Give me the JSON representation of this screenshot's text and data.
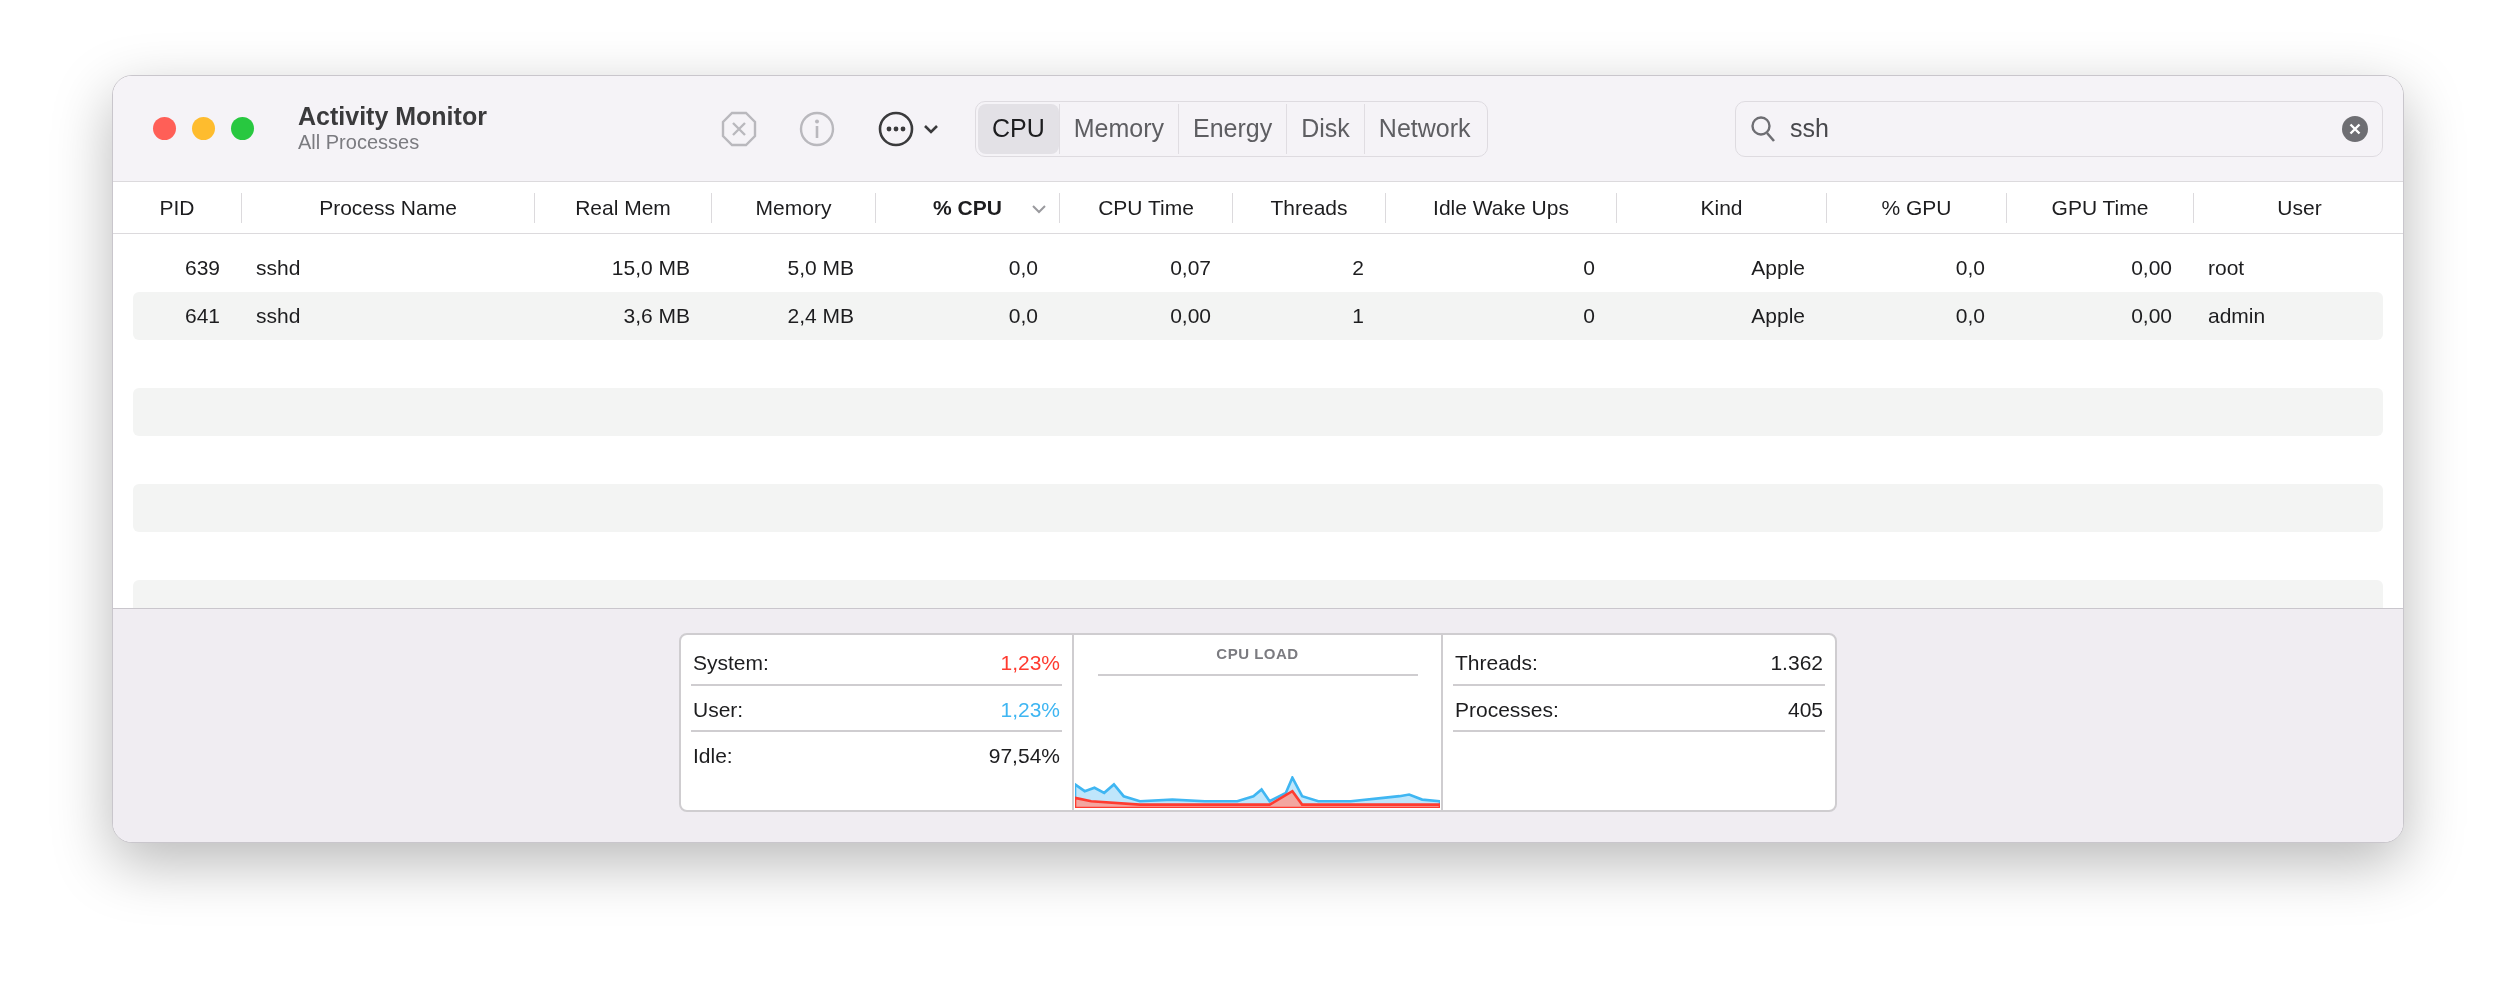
{
  "window": {
    "title": "Activity Monitor",
    "subtitle": "All Processes"
  },
  "tabs": [
    {
      "label": "CPU",
      "selected": true
    },
    {
      "label": "Memory",
      "selected": false
    },
    {
      "label": "Energy",
      "selected": false
    },
    {
      "label": "Disk",
      "selected": false
    },
    {
      "label": "Network",
      "selected": false
    }
  ],
  "search": {
    "value": "ssh"
  },
  "table": {
    "columns": [
      {
        "label": "PID",
        "sorted": false
      },
      {
        "label": "Process Name",
        "sorted": false
      },
      {
        "label": "Real Mem",
        "sorted": false
      },
      {
        "label": "Memory",
        "sorted": false
      },
      {
        "label": "% CPU",
        "sorted": true
      },
      {
        "label": "CPU Time",
        "sorted": false
      },
      {
        "label": "Threads",
        "sorted": false
      },
      {
        "label": "Idle Wake Ups",
        "sorted": false
      },
      {
        "label": "Kind",
        "sorted": false
      },
      {
        "label": "% GPU",
        "sorted": false
      },
      {
        "label": "GPU Time",
        "sorted": false
      },
      {
        "label": "User",
        "sorted": false
      }
    ],
    "rows": [
      [
        "639",
        "sshd",
        "15,0 MB",
        "5,0 MB",
        "0,0",
        "0,07",
        "2",
        "0",
        "Apple",
        "0,0",
        "0,00",
        "root"
      ],
      [
        "641",
        "sshd",
        "3,6 MB",
        "2,4 MB",
        "0,0",
        "0,00",
        "1",
        "0",
        "Apple",
        "0,0",
        "0,00",
        "admin"
      ]
    ]
  },
  "summary": {
    "cpu": [
      {
        "label": "System:",
        "value": "1,23%",
        "color": "#ff3b30"
      },
      {
        "label": "User:",
        "value": "1,23%",
        "color": "#3fb6f2"
      },
      {
        "label": "Idle:",
        "value": "97,54%",
        "color": "#1d1d1f"
      }
    ],
    "chart_title": "CPU LOAD",
    "counts": [
      {
        "label": "Threads:",
        "value": "1.362"
      },
      {
        "label": "Processes:",
        "value": "405"
      }
    ]
  }
}
